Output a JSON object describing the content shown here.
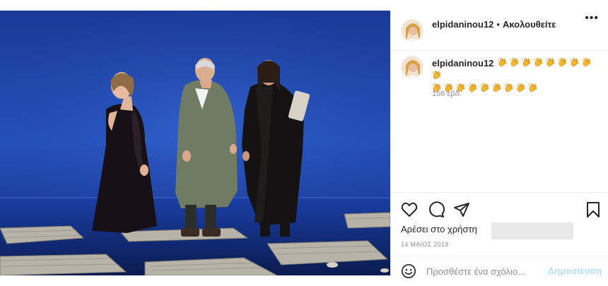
{
  "header": {
    "username": "elpidaninou12",
    "separator": "•",
    "follow_label": "Ακολουθείτε",
    "more_icon": "more-horizontal-icon"
  },
  "caption": {
    "username": "elpidaninou12",
    "emoji": "clapping-hands",
    "emoji_count_line1": 9,
    "emoji_count_line2": 9,
    "time_ago": "156 εβδ."
  },
  "actions": {
    "like_icon": "heart-icon",
    "comment_icon": "comment-icon",
    "share_icon": "share-icon",
    "save_icon": "bookmark-icon",
    "likes_text": "Αρέσει στο χρήστη",
    "date": "14 ΜΑΙΟΣ 2018"
  },
  "comment_bar": {
    "placeholder": "Προσθέστε ένα σχόλιο...",
    "post_label": "Δημοσίευση",
    "emoji_icon": "smiley-icon"
  },
  "colors": {
    "stage_blue": "#1b3d9a",
    "muted_text": "#8e8e8e",
    "disabled_blue": "#b2dffc",
    "border": "#efefef"
  }
}
